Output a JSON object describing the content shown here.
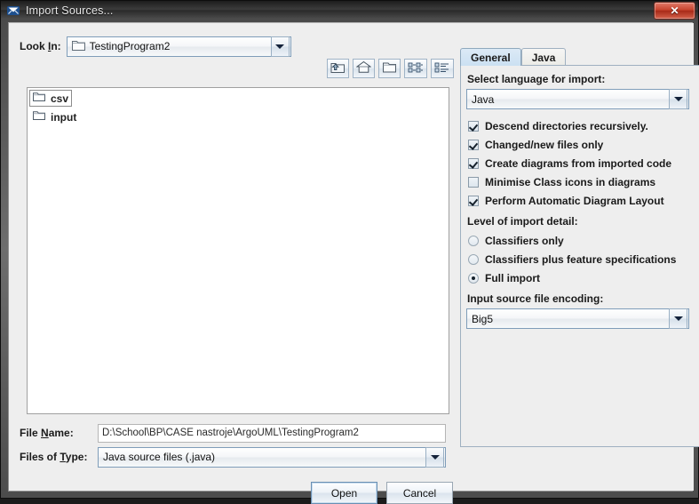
{
  "window": {
    "title": "Import Sources...",
    "app_icon": "argouml-icon",
    "close_label": "✕"
  },
  "chooser": {
    "lookin_label_pre": "Look ",
    "lookin_label_key": "I",
    "lookin_label_post": "n:",
    "lookin_value": "TestingProgram2",
    "toolbar": [
      {
        "name": "up-one-level-icon",
        "tooltip": "Up One Level"
      },
      {
        "name": "home-icon",
        "tooltip": "Home"
      },
      {
        "name": "new-folder-icon",
        "tooltip": "Create New Folder"
      },
      {
        "name": "list-view-icon",
        "tooltip": "List"
      },
      {
        "name": "details-view-icon",
        "tooltip": "Details"
      }
    ],
    "files": [
      {
        "name": "csv",
        "type": "folder",
        "focused": true
      },
      {
        "name": "input",
        "type": "folder",
        "focused": false
      }
    ],
    "filename_label_pre": "File ",
    "filename_label_key": "N",
    "filename_label_post": "ame:",
    "filename_value": "D:\\School\\BP\\CASE nastroje\\ArgoUML\\TestingProgram2",
    "filetype_label_pre": "Files of ",
    "filetype_label_key": "T",
    "filetype_label_post": "ype:",
    "filetype_value": "Java source files (.java)",
    "open_label": "Open",
    "cancel_label": "Cancel"
  },
  "options": {
    "tabs": [
      {
        "label": "General",
        "active": true
      },
      {
        "label": "Java",
        "active": false
      }
    ],
    "language_label": "Select language for import:",
    "language_value": "Java",
    "checkboxes": [
      {
        "label": "Descend directories recursively.",
        "checked": true
      },
      {
        "label": "Changed/new files only",
        "checked": true
      },
      {
        "label": "Create diagrams from imported code",
        "checked": true
      },
      {
        "label": "Minimise Class icons in diagrams",
        "checked": false
      },
      {
        "label": "Perform Automatic Diagram Layout",
        "checked": true
      }
    ],
    "detail_label": "Level of import detail:",
    "radios": [
      {
        "label": "Classifiers only",
        "selected": false
      },
      {
        "label": "Classifiers plus feature specifications",
        "selected": false
      },
      {
        "label": "Full import",
        "selected": true
      }
    ],
    "encoding_label": "Input source file encoding:",
    "encoding_value": "Big5"
  },
  "colors": {
    "accent": "#7f9db9",
    "panel_bg": "#eeeeee",
    "active_tab": "#cbe0f2",
    "close_red": "#c8442e"
  }
}
